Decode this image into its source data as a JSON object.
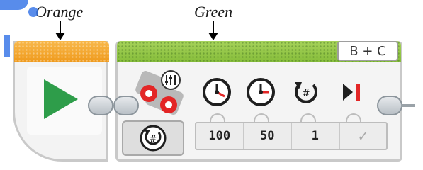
{
  "annotations": {
    "orange": "Orange",
    "green": "Green"
  },
  "blocks": {
    "start": {
      "icon": "play-icon",
      "color": "#2e9d4a",
      "bar_color": "#f5a623"
    },
    "move_tank": {
      "bar_color": "#8cc63f",
      "ports": "B + C",
      "icons": [
        "tank-motor-icon",
        "mode-icon",
        "left-power-icon",
        "right-power-icon",
        "rotations-icon",
        "brake-icon"
      ],
      "values": [
        "100",
        "50",
        "1",
        "✓"
      ]
    }
  }
}
